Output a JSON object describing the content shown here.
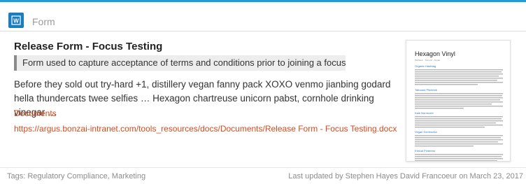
{
  "header": {
    "type_label": "Form",
    "icon": "word-document-icon",
    "icon_letter": "W"
  },
  "item": {
    "title": "Release Form - Focus Testing",
    "summary": "Form used to capture acceptance of terms and conditions prior to joining a focus test.",
    "body": "Before they sold out try-hard +1, distillery vegan fanny pack XOXO venmo jianbing godard hella thundercats twee selfies … Hexagon chartreuse unicorn pabst, cornhole drinking vinegar …",
    "breadcrumb": "Documents",
    "url": "https://argus.bonzai-intranet.com/tools_resources/docs/Documents/Release Form - Focus Testing.docx"
  },
  "thumbnail": {
    "heading": "Hexagon Vinyl",
    "sections": [
      "Organic Hashtag",
      "Tattooed Pitchfork",
      "Kale Normcore",
      "Vegan Kombucha",
      "Ethical Pinterest"
    ]
  },
  "footer": {
    "tags": "Tags: Regulatory Compliance, Marketing",
    "updated": "Last updated by Stephen Hayes David Francoeur on March 23, 2017"
  },
  "colors": {
    "accent": "#1aa0d6",
    "icon_bg": "#1b7dbd",
    "link": "#d94a1e",
    "muted": "#8c8c8c"
  }
}
